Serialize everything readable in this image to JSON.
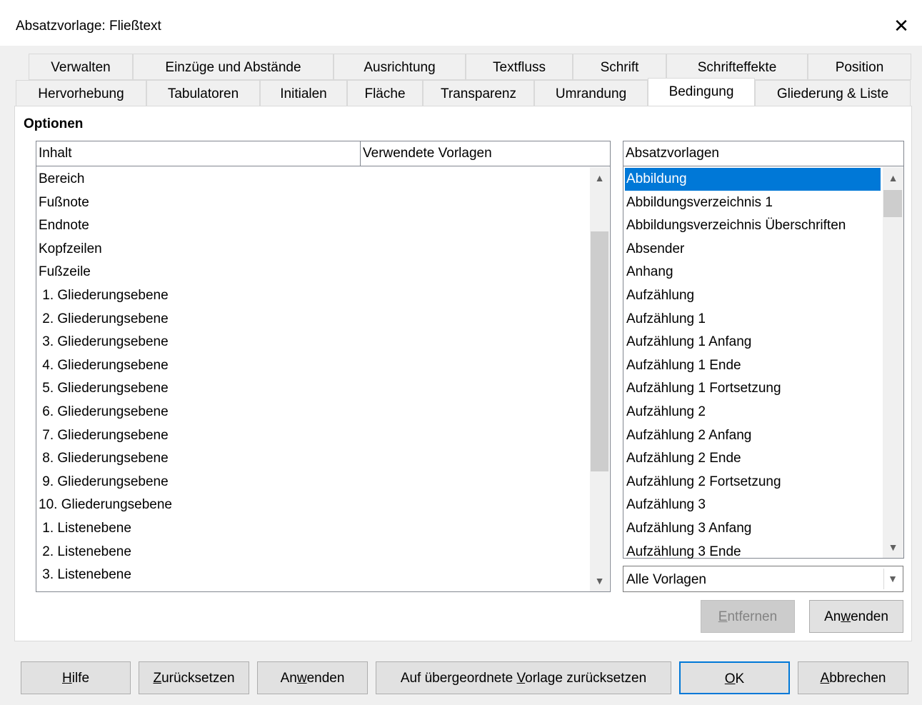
{
  "window": {
    "title": "Absatzvorlage: Fließtext",
    "close_glyph": "✕"
  },
  "tabs_row1": [
    "Verwalten",
    "Einzüge und Abstände",
    "Ausrichtung",
    "Textfluss",
    "Schrift",
    "Schrifteffekte",
    "Position"
  ],
  "tabs_row2": [
    "Hervorhebung",
    "Tabulatoren",
    "Initialen",
    "Fläche",
    "Transparenz",
    "Umrandung",
    "Bedingung",
    "Gliederung & Liste"
  ],
  "active_tab": "Bedingung",
  "section": {
    "title": "Optionen"
  },
  "content_list": {
    "columns": [
      "Inhalt",
      "Verwendete Vorlagen"
    ],
    "rows": [
      "Bereich",
      "Fußnote",
      "Endnote",
      "Kopfzeilen",
      "Fußzeile",
      " 1. Gliederungsebene",
      " 2. Gliederungsebene",
      " 3. Gliederungsebene",
      " 4. Gliederungsebene",
      " 5. Gliederungsebene",
      " 6. Gliederungsebene",
      " 7. Gliederungsebene",
      " 8. Gliederungsebene",
      " 9. Gliederungsebene",
      "10. Gliederungsebene",
      " 1. Listenebene",
      " 2. Listenebene",
      " 3. Listenebene"
    ]
  },
  "styles_list": {
    "header": "Absatzvorlagen",
    "selected": "Abbildung",
    "rows": [
      "Abbildung",
      "Abbildungsverzeichnis 1",
      "Abbildungsverzeichnis Überschriften",
      "Absender",
      "Anhang",
      "Aufzählung",
      "Aufzählung 1",
      "Aufzählung 1 Anfang",
      "Aufzählung 1 Ende",
      "Aufzählung 1 Fortsetzung",
      "Aufzählung 2",
      "Aufzählung 2 Anfang",
      "Aufzählung 2 Ende",
      "Aufzählung 2 Fortsetzung",
      "Aufzählung 3",
      "Aufzählung 3 Anfang",
      "Aufzählung 3 Ende"
    ]
  },
  "filter": {
    "value": "Alle Vorlagen"
  },
  "panel_buttons": {
    "remove": {
      "before": "",
      "mnemonic": "E",
      "after": "ntfernen"
    },
    "apply": {
      "before": "An",
      "mnemonic": "w",
      "after": "enden"
    }
  },
  "footer_buttons": {
    "help": {
      "before": "",
      "mnemonic": "H",
      "after": "ilfe"
    },
    "reset": {
      "before": "",
      "mnemonic": "Z",
      "after": "urücksetzen"
    },
    "apply": {
      "before": "An",
      "mnemonic": "w",
      "after": "enden"
    },
    "parent": {
      "before": "Auf übergeordnete ",
      "mnemonic": "V",
      "after": "orlage zurücksetzen"
    },
    "ok": {
      "before": "",
      "mnemonic": "O",
      "after": "K"
    },
    "cancel": {
      "before": "",
      "mnemonic": "A",
      "after": "bbrechen"
    }
  },
  "icons": {
    "scroll_up": "chevron-up",
    "scroll_down": "chevron-down",
    "dropdown": "chevron-down"
  },
  "colors": {
    "selection": "#0078d7",
    "default_button_border": "#0078d7"
  }
}
